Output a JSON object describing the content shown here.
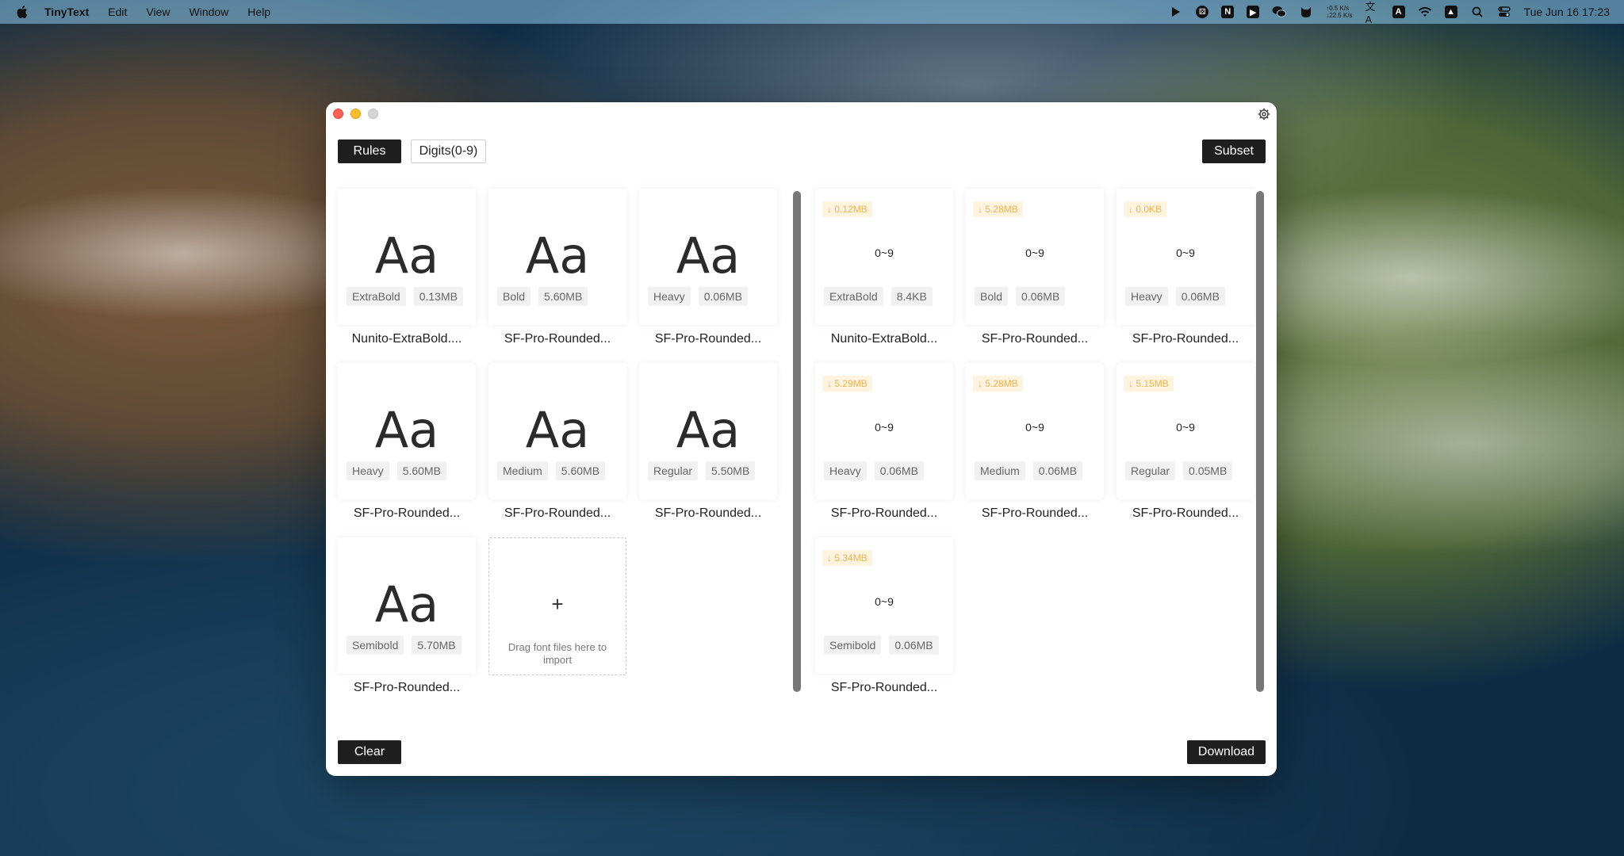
{
  "menubar": {
    "app_name": "TinyText",
    "menus": [
      "Edit",
      "View",
      "Window",
      "Help"
    ],
    "netspeed_up": "↑0.5 K/s",
    "netspeed_down": "↓22.5 K/s",
    "clock": "Tue Jun 16  17:23"
  },
  "window": {
    "rules_label": "Rules",
    "rule_tag": "Digits(0-9)",
    "subset_label": "Subset",
    "clear_label": "Clear",
    "download_label": "Download",
    "drop_zone": {
      "plus": "+",
      "text": "Drag font files here to import"
    }
  },
  "source_fonts": [
    {
      "preview": "Aa",
      "weight": "ExtraBold",
      "size": "0.13MB",
      "name": "Nunito-ExtraBold...."
    },
    {
      "preview": "Aa",
      "weight": "Bold",
      "size": "5.60MB",
      "name": "SF-Pro-Rounded..."
    },
    {
      "preview": "Aa",
      "weight": "Heavy",
      "size": "0.06MB",
      "name": "SF-Pro-Rounded..."
    },
    {
      "preview": "Aa",
      "weight": "Heavy",
      "size": "5.60MB",
      "name": "SF-Pro-Rounded..."
    },
    {
      "preview": "Aa",
      "weight": "Medium",
      "size": "5.60MB",
      "name": "SF-Pro-Rounded..."
    },
    {
      "preview": "Aa",
      "weight": "Regular",
      "size": "5.50MB",
      "name": "SF-Pro-Rounded..."
    },
    {
      "preview": "Aa",
      "weight": "Semibold",
      "size": "5.70MB",
      "name": "SF-Pro-Rounded..."
    }
  ],
  "subset_fonts": [
    {
      "saved": "↓ 0.12MB",
      "preview": "0~9",
      "weight": "ExtraBold",
      "size": "8.4KB",
      "name": "Nunito-ExtraBold..."
    },
    {
      "saved": "↓ 5.28MB",
      "preview": "0~9",
      "weight": "Bold",
      "size": "0.06MB",
      "name": "SF-Pro-Rounded..."
    },
    {
      "saved": "↓ 0.0KB",
      "preview": "0~9",
      "weight": "Heavy",
      "size": "0.06MB",
      "name": "SF-Pro-Rounded..."
    },
    {
      "saved": "↓ 5.29MB",
      "preview": "0~9",
      "weight": "Heavy",
      "size": "0.06MB",
      "name": "SF-Pro-Rounded..."
    },
    {
      "saved": "↓ 5.28MB",
      "preview": "0~9",
      "weight": "Medium",
      "size": "0.06MB",
      "name": "SF-Pro-Rounded..."
    },
    {
      "saved": "↓ 5.15MB",
      "preview": "0~9",
      "weight": "Regular",
      "size": "0.05MB",
      "name": "SF-Pro-Rounded..."
    },
    {
      "saved": "↓ 5.34MB",
      "preview": "0~9",
      "weight": "Semibold",
      "size": "0.06MB",
      "name": "SF-Pro-Rounded..."
    }
  ],
  "colors": {
    "save_badge_text": "#f0b34e",
    "save_badge_bg": "#fdf3df",
    "dark_button": "#1f1f1f"
  }
}
